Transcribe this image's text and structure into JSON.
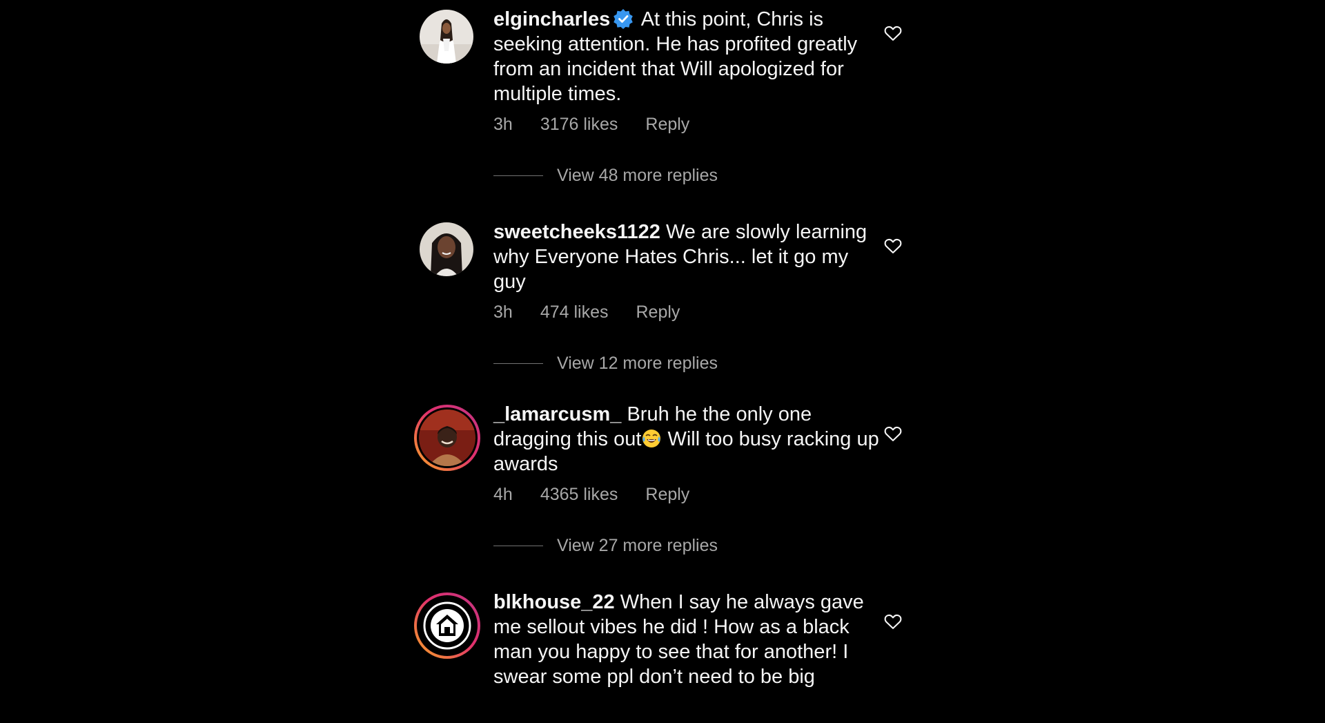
{
  "comments": [
    {
      "username": "elgincharles",
      "verified": true,
      "text": "At this point, Chris is seeking attention. He has profited greatly from an incident that Will apologized for multiple times.",
      "time": "3h",
      "likes": "3176 likes",
      "reply": "Reply",
      "view_replies": "View 48 more replies"
    },
    {
      "username": "sweetcheeks1122",
      "verified": false,
      "text": "We are slowly learning why Everyone Hates Chris... let it go my guy",
      "time": "3h",
      "likes": "474 likes",
      "reply": "Reply",
      "view_replies": "View 12 more replies"
    },
    {
      "username": "_lamarcusm_",
      "verified": false,
      "text_before_emoji": "Bruh he the only one dragging this out",
      "emoji": "face-with-tears-of-joy",
      "text_after_emoji": " Will too busy racking up awards",
      "time": "4h",
      "likes": "4365 likes",
      "reply": "Reply",
      "view_replies": "View 27 more replies"
    },
    {
      "username": "blkhouse_22",
      "verified": false,
      "text": "When I say he always gave me sellout vibes he did ! How as a black man you happy to see that for another! I swear some ppl don’t need to be big"
    }
  ],
  "icons": {
    "like": "heart-outline-icon",
    "verified": "verified-badge-icon"
  },
  "colors": {
    "background": "#000000",
    "text": "#f5f5f5",
    "secondary_text": "#a8a8a8",
    "verified_blue": "#3897f0",
    "story_ring_start": "#f9a825",
    "story_ring_end": "#c13584"
  }
}
